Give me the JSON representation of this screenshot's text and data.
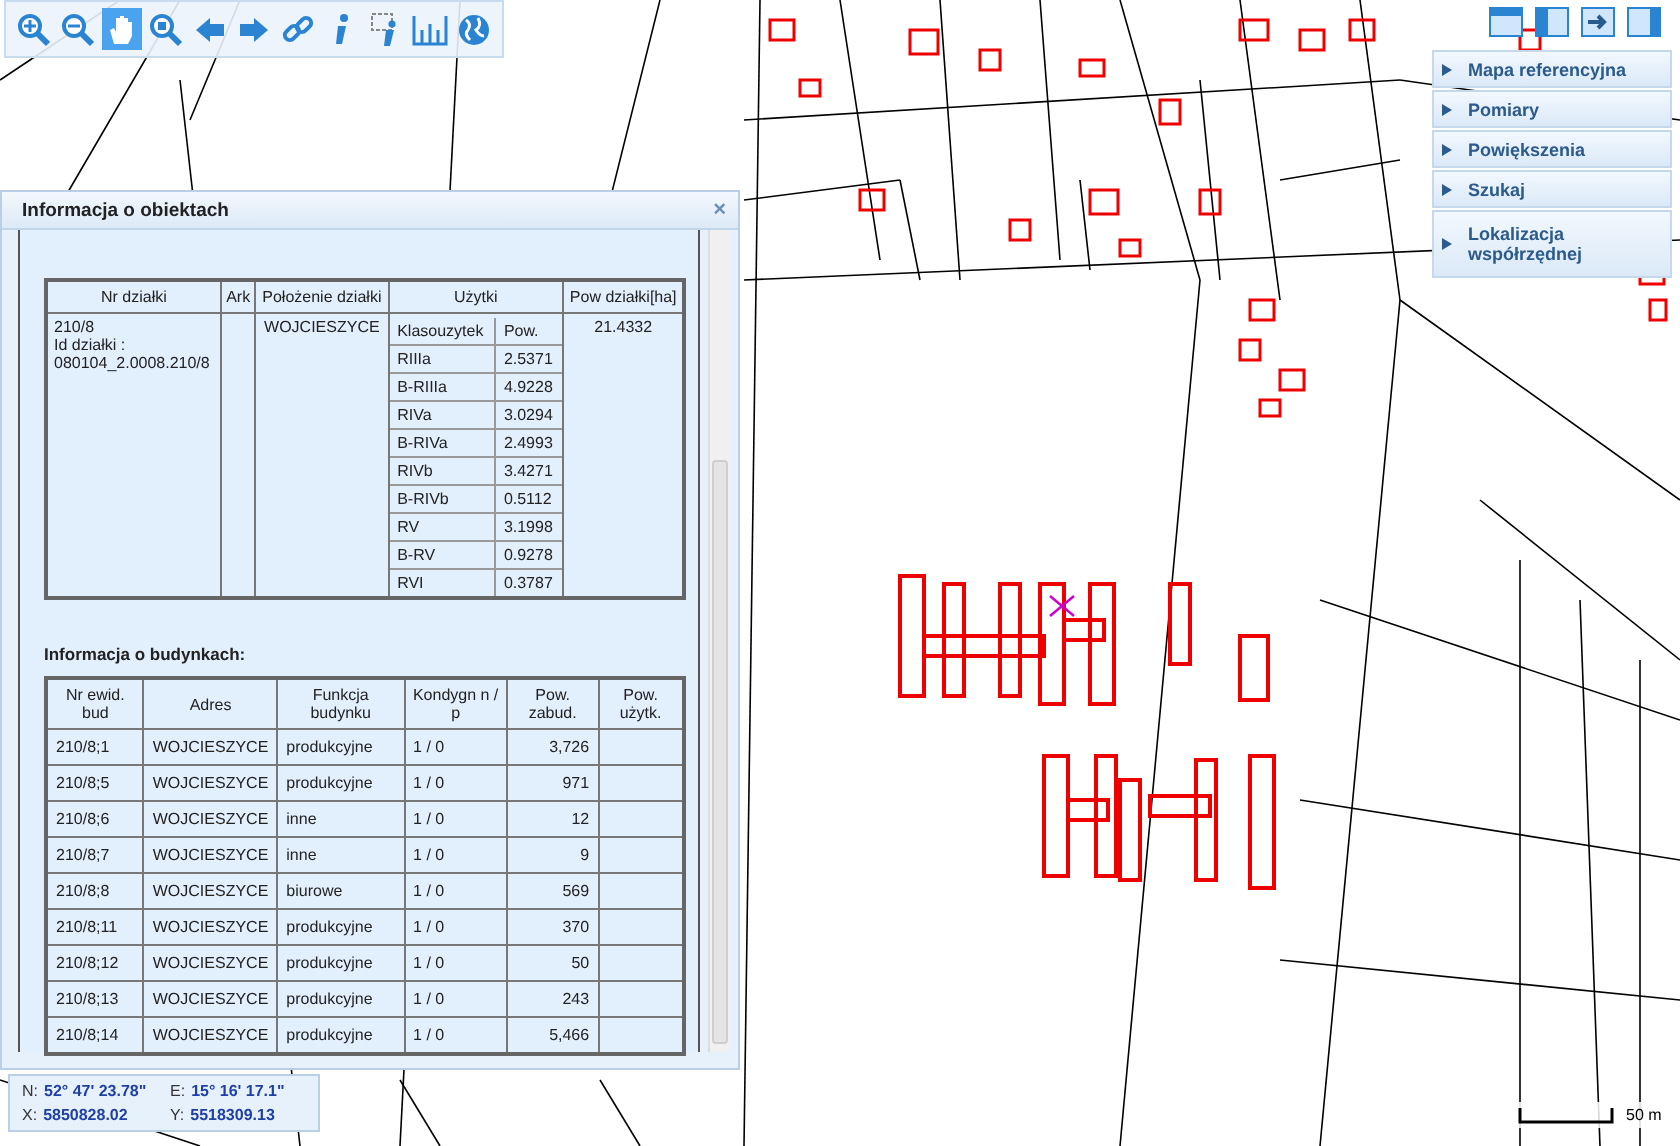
{
  "toolbar": [
    {
      "kind": "zoom-in",
      "selected": false
    },
    {
      "kind": "zoom-out",
      "selected": false
    },
    {
      "kind": "pan",
      "selected": true
    },
    {
      "kind": "zoom-box",
      "selected": false
    },
    {
      "kind": "back",
      "selected": false
    },
    {
      "kind": "forward",
      "selected": false
    },
    {
      "kind": "link",
      "selected": false
    },
    {
      "kind": "info",
      "selected": false
    },
    {
      "kind": "info-select",
      "selected": false
    },
    {
      "kind": "measure",
      "selected": false
    },
    {
      "kind": "globe",
      "selected": false
    }
  ],
  "side_menu": {
    "items": [
      "Mapa referencyjna",
      "Pomiary",
      "Powiększenia",
      "Szukaj",
      "Lokalizacja współrzędnej"
    ]
  },
  "info_panel": {
    "title": "Informacja o obiektach",
    "close": "×",
    "parcel_table": {
      "columns": [
        "Nr działki",
        "Ark",
        "Położenie działki",
        "Użytki",
        "Pow działki[ha]"
      ],
      "rows": [
        {
          "nr": "210/8",
          "id_label": "Id działki :",
          "id_value": "080104_2.0008.210/8",
          "ark": "",
          "polozenie": "WOJCIESZYCE",
          "pow": "21.4332",
          "uzytki_columns": [
            "Klasouzytek",
            "Pow."
          ],
          "uzytki": [
            {
              "klasa": "RIIIa",
              "pow": "2.5371"
            },
            {
              "klasa": "B-RIIIa",
              "pow": "4.9228"
            },
            {
              "klasa": "RIVa",
              "pow": "3.0294"
            },
            {
              "klasa": "B-RIVa",
              "pow": "2.4993"
            },
            {
              "klasa": "RIVb",
              "pow": "3.4271"
            },
            {
              "klasa": "B-RIVb",
              "pow": "0.5112"
            },
            {
              "klasa": "RV",
              "pow": "3.1998"
            },
            {
              "klasa": "B-RV",
              "pow": "0.9278"
            },
            {
              "klasa": "RVI",
              "pow": "0.3787"
            }
          ]
        }
      ]
    },
    "buildings_heading": "Informacja o budynkach:",
    "buildings_table": {
      "columns": [
        "Nr ewid. bud",
        "Adres",
        "Funkcja budynku",
        "Kondygn n / p",
        "Pow. zabud.",
        "Pow. użytk."
      ],
      "rows": [
        [
          "210/8;1",
          "WOJCIESZYCE",
          "produkcyjne",
          "1 / 0",
          "3,726",
          ""
        ],
        [
          "210/8;5",
          "WOJCIESZYCE",
          "produkcyjne",
          "1 / 0",
          "971",
          ""
        ],
        [
          "210/8;6",
          "WOJCIESZYCE",
          "inne",
          "1 / 0",
          "12",
          ""
        ],
        [
          "210/8;7",
          "WOJCIESZYCE",
          "inne",
          "1 / 0",
          "9",
          ""
        ],
        [
          "210/8;8",
          "WOJCIESZYCE",
          "biurowe",
          "1 / 0",
          "569",
          ""
        ],
        [
          "210/8;11",
          "WOJCIESZYCE",
          "produkcyjne",
          "1 / 0",
          "370",
          ""
        ],
        [
          "210/8;12",
          "WOJCIESZYCE",
          "produkcyjne",
          "1 / 0",
          "50",
          ""
        ],
        [
          "210/8;13",
          "WOJCIESZYCE",
          "produkcyjne",
          "1 / 0",
          "243",
          ""
        ],
        [
          "210/8;14",
          "WOJCIESZYCE",
          "produkcyjne",
          "1 / 0",
          "5,466",
          ""
        ]
      ]
    }
  },
  "coordinates": [
    {
      "label": "N:",
      "value": "52° 47' 23.78\""
    },
    {
      "label": "E:",
      "value": "15° 16' 17.1\""
    },
    {
      "label": "X:",
      "value": "5850828.02"
    },
    {
      "label": "Y:",
      "value": "5518309.13"
    }
  ],
  "scale": {
    "label": "50 m"
  }
}
